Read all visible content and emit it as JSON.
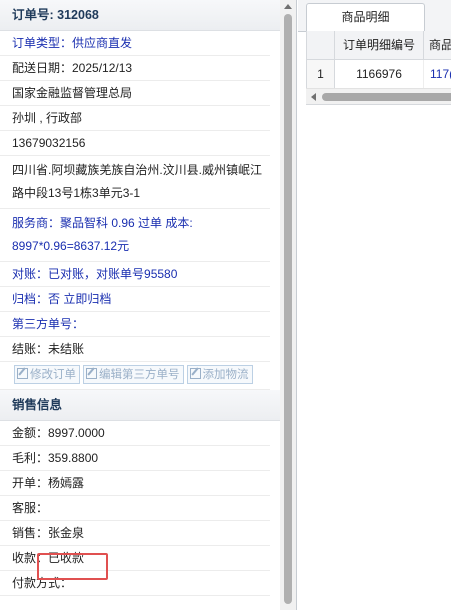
{
  "order": {
    "header_label": "订单号: ",
    "order_no": "312068",
    "type": "订单类型：供应商直发",
    "delivery_date": "配送日期：2025/12/13",
    "org": "国家金融监督管理总局",
    "contact": "孙圳 , 行政部",
    "phone": "13679032156",
    "address_line1": "四川省.阿坝藏族羌族自治州.汶川县.威州镇岷江",
    "address_line2": "路中段13号1栋3单元3-1",
    "supplier_line1": "服务商：聚品智科 0.96 过单 成本:",
    "supplier_line2": "8997*0.96=8637.12元",
    "reconcile_label": "对账：",
    "reconcile_value": "已对账，对账单号95580",
    "archive_label": "归档：",
    "archive_status": "否",
    "archive_action": "立即归档",
    "third_party_no": "第三方单号：",
    "settlement": "结账：未结账",
    "buttons": [
      "修改订单",
      "编辑第三方单号",
      "添加物流"
    ]
  },
  "sales": {
    "header": "销售信息",
    "amount": "金额：8997.0000",
    "profit": "毛利：359.8800",
    "invoice": "开单：杨嫣露",
    "service": "客服：",
    "seller": "销售：张金泉",
    "payment_label": "收款：",
    "payment_value": "已收款",
    "payment_method": "付款方式："
  },
  "details": {
    "tab": "商品明细",
    "columns": [
      "",
      "订单明细编号",
      "商品"
    ],
    "rows": [
      {
        "index": "1",
        "detail_no": "1166976",
        "product": "117("
      }
    ]
  },
  "colors": {
    "link_blue": "#1a2fb0",
    "highlight_red": "#e05050"
  }
}
